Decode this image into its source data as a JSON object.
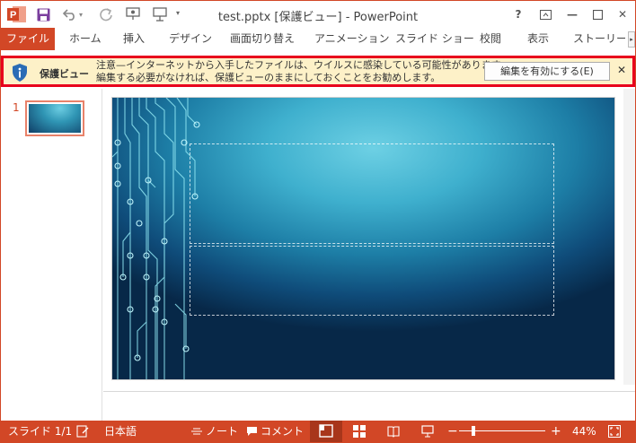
{
  "window": {
    "title": "test.pptx [保護ビュー] - PowerPoint",
    "help": "?",
    "minimize": "—",
    "close": "✕"
  },
  "ribbon": {
    "tabs": [
      {
        "label": "ファイル"
      },
      {
        "label": "ホーム"
      },
      {
        "label": "挿入"
      },
      {
        "label": "デザイン"
      },
      {
        "label": "画面切り替え"
      },
      {
        "label": "アニメーション"
      },
      {
        "label": "スライド ショー"
      },
      {
        "label": "校閲"
      },
      {
        "label": "表示"
      },
      {
        "label": "ストーリーボ"
      }
    ],
    "scroll_glyph": "▸"
  },
  "protected_view": {
    "title": "保護ビュー",
    "line1": "注意—インターネットから入手したファイルは、ウイルスに感染している可能性があります。",
    "line2": "編集する必要がなければ、保護ビューのままにしておくことをお勧めします。",
    "enable_button": "編集を有効にする(E)",
    "close": "✕"
  },
  "thumbnails": [
    {
      "number": "1"
    }
  ],
  "statusbar": {
    "slide_info": "スライド 1/1",
    "language": "日本語",
    "notes": "ノート",
    "comments": "コメント",
    "zoom_minus": "−",
    "zoom_plus": "+",
    "zoom_level": "44%"
  },
  "colors": {
    "accent": "#d24726",
    "warning_bar": "#fdf1c8",
    "highlight_border": "#e8001c"
  }
}
